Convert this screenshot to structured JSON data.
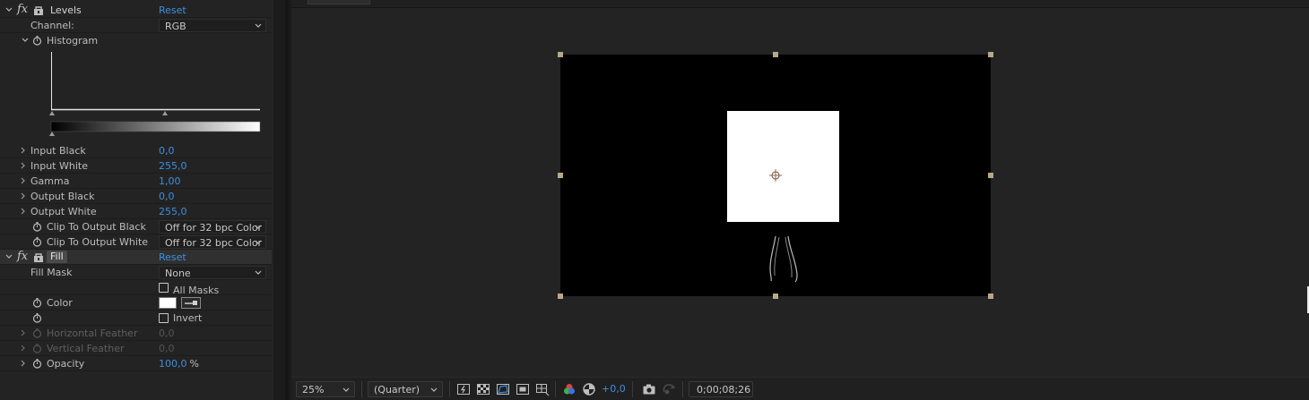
{
  "levels": {
    "name": "Levels",
    "reset": "Reset",
    "channel_label": "Channel:",
    "channel_value": "RGB",
    "histogram_label": "Histogram",
    "props": [
      {
        "label": "Input Black",
        "value": "0,0"
      },
      {
        "label": "Input White",
        "value": "255,0"
      },
      {
        "label": "Gamma",
        "value": "1,00"
      },
      {
        "label": "Output Black",
        "value": "0,0"
      },
      {
        "label": "Output White",
        "value": "255,0"
      }
    ],
    "clip_black_label": "Clip To Output Black",
    "clip_black_value": "Off for 32 bpc Color",
    "clip_white_label": "Clip To Output White",
    "clip_white_value": "Off for 32 bpc Color"
  },
  "fill": {
    "name": "Fill",
    "reset": "Reset",
    "fill_mask_label": "Fill Mask",
    "fill_mask_value": "None",
    "all_masks_label": "All Masks",
    "color_label": "Color",
    "color_value": "#ffffff",
    "invert_label": "Invert",
    "horizontal_feather_label": "Horizontal Feather",
    "horizontal_feather_value": "0,0",
    "vertical_feather_label": "Vertical Feather",
    "vertical_feather_value": "0,0",
    "opacity_label": "Opacity",
    "opacity_value": "100,0",
    "opacity_unit": "%"
  },
  "viewer": {
    "zoom": "25%",
    "resolution": "(Quarter)",
    "exposure": "+0,0",
    "timecode": "0;00;08;26"
  },
  "colors": {
    "accent": "#3f8ee0",
    "panel_bg": "#232323",
    "handle": "#b7a889"
  },
  "icons": [
    "fx-icon",
    "lock-icon",
    "stopwatch-icon",
    "chevron-right-icon",
    "chevron-down-icon",
    "eyedropper-icon",
    "camera-icon",
    "color-channels-icon",
    "reset-exposure-icon",
    "grid-icon",
    "mask-icon",
    "region-icon"
  ]
}
